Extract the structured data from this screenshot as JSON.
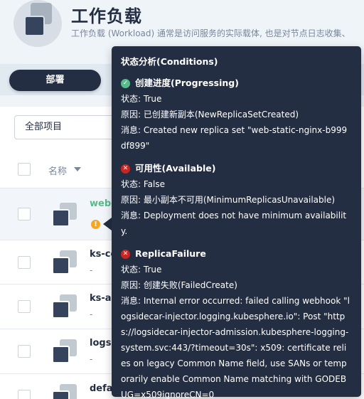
{
  "header": {
    "title": "工作负载",
    "description": "工作负载 (Workload) 通常是访问服务的实际载体, 也是对节点日志收集、"
  },
  "tabs": [
    {
      "label": "部署",
      "active": true
    }
  ],
  "filter": {
    "selected": "全部项目"
  },
  "table": {
    "column_name": "名称",
    "rows": [
      {
        "name": "web-",
        "sub": "",
        "warning": true,
        "link": true
      },
      {
        "name": "ks-co",
        "sub": "-"
      },
      {
        "name": "ks-ap",
        "sub": "-"
      },
      {
        "name": "logsi",
        "sub": "-"
      },
      {
        "name": "defau",
        "sub": ""
      }
    ]
  },
  "tooltip": {
    "title": "状态分析(Conditions)",
    "conditions": [
      {
        "status_icon": "check-circle-icon",
        "name": "创建进度(Progressing)",
        "status": "状态: True",
        "reason": "原因: 已创建新副本(NewReplicaSetCreated)",
        "message": "消息: Created new replica set \"web-static-nginx-b999df899\""
      },
      {
        "status_icon": "error-circle-icon",
        "name": "可用性(Available)",
        "status": "状态: False",
        "reason": "原因: 最小副本不可用(MinimumReplicasUnavailable)",
        "message": "消息: Deployment does not have minimum availability."
      },
      {
        "status_icon": "error-circle-icon",
        "name": "ReplicaFailure",
        "status": "状态: True",
        "reason": "原因: 创建失败(FailedCreate)",
        "message": "消息: Internal error occurred: failed calling webhook \"logsidecar-injector.logging.kubesphere.io\": Post \"https://logsidecar-injector-admission.kubesphere-logging-system.svc:443/?timeout=30s\": x509: certificate relies on legacy Common Name field, use SANs or temporarily enable Common Name matching with GODEBUG=x509ignoreCN=0"
      }
    ]
  },
  "colors": {
    "dark": "#242e42",
    "success": "#55bc8a",
    "error": "#ca2621",
    "warning": "#f5a623"
  }
}
